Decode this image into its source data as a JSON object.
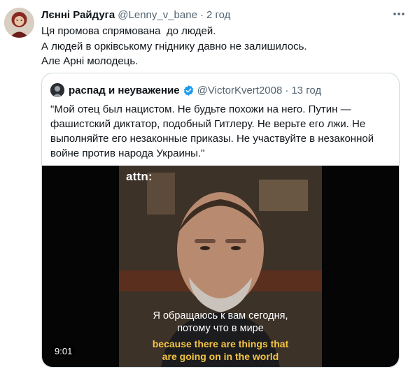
{
  "tweet": {
    "display_name": "Лєнні Райдуга",
    "handle": "@Lenny_v_bane",
    "separator": "·",
    "time": "2 год",
    "text_lines": [
      "Ця промова спрямована  до людей.",
      "А людей в орківському гніднику давно не залишилось.",
      "Але Арні молодець."
    ]
  },
  "quoted_tweet": {
    "display_name": "распад и неуважение",
    "handle": "@VictorKvert2008",
    "separator": "·",
    "time": "13 год",
    "verified": true,
    "text_lines": [
      "\"Мой отец был нацистом. Не будьте похожи на него. Путин —",
      "фашистский диктатор, подобный Гитлеру. Не верьте его лжи. Не",
      "выполняйте его незаконные приказы. Не участвуйте в незаконной",
      "войне против народа Украины.\""
    ]
  },
  "video": {
    "watermark": "attn:",
    "subtitle_ru": [
      "Я обращаюсь к вам сегодня,",
      "потому что в мире"
    ],
    "subtitle_en": [
      "because there are things that",
      "are going on in the world"
    ],
    "duration": "9:01"
  },
  "icons": {
    "more": "more-horizontal-icon",
    "verified": "verified-badge-icon"
  },
  "colors": {
    "text": "#0f1419",
    "muted": "#536471",
    "verified": "#1d9bf0",
    "border": "#cfd9de",
    "subtitle_en": "#f4c542"
  }
}
